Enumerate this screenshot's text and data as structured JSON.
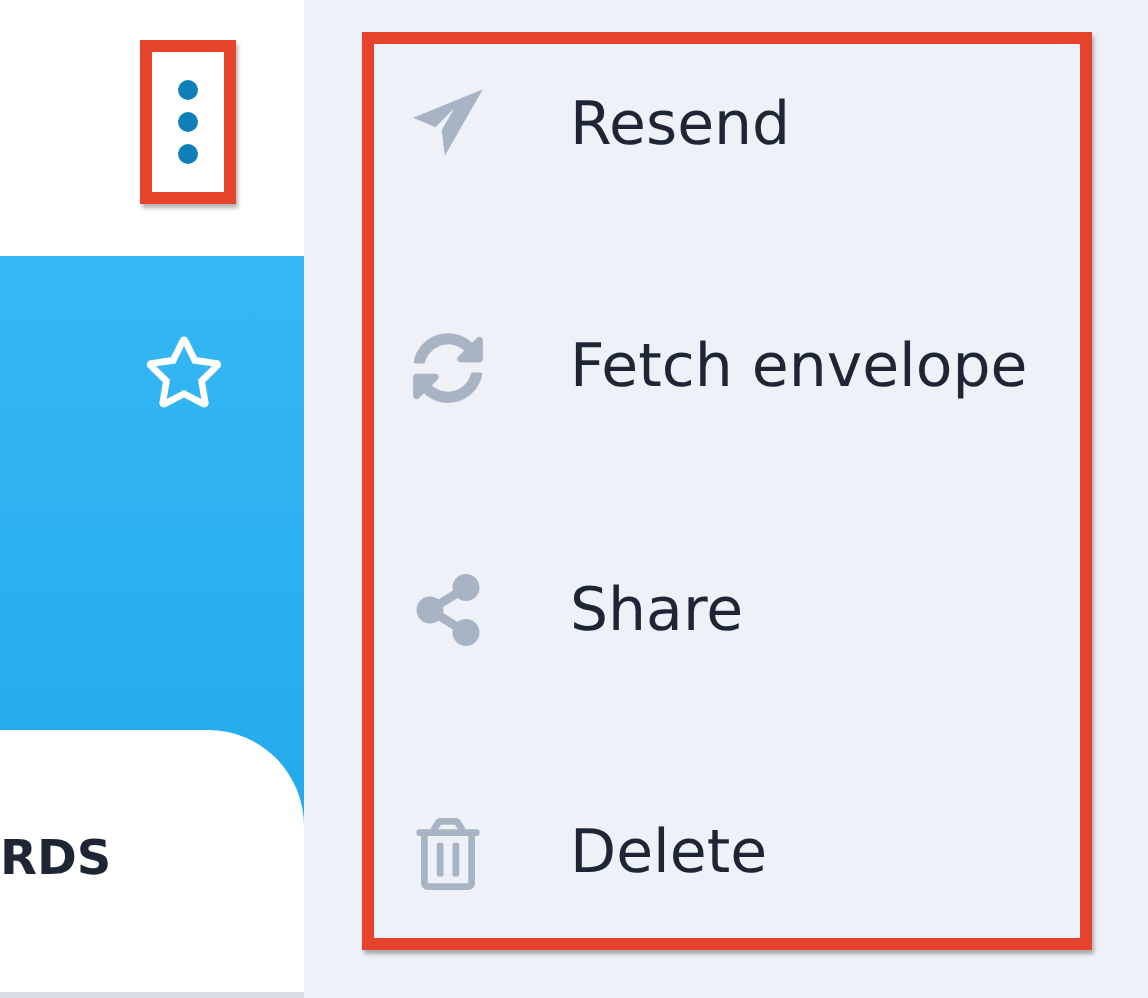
{
  "card": {
    "tab_label": "RDS"
  },
  "menu": {
    "items": [
      {
        "label": "Resend"
      },
      {
        "label": "Fetch envelope"
      },
      {
        "label": "Share"
      },
      {
        "label": "Delete"
      }
    ]
  }
}
